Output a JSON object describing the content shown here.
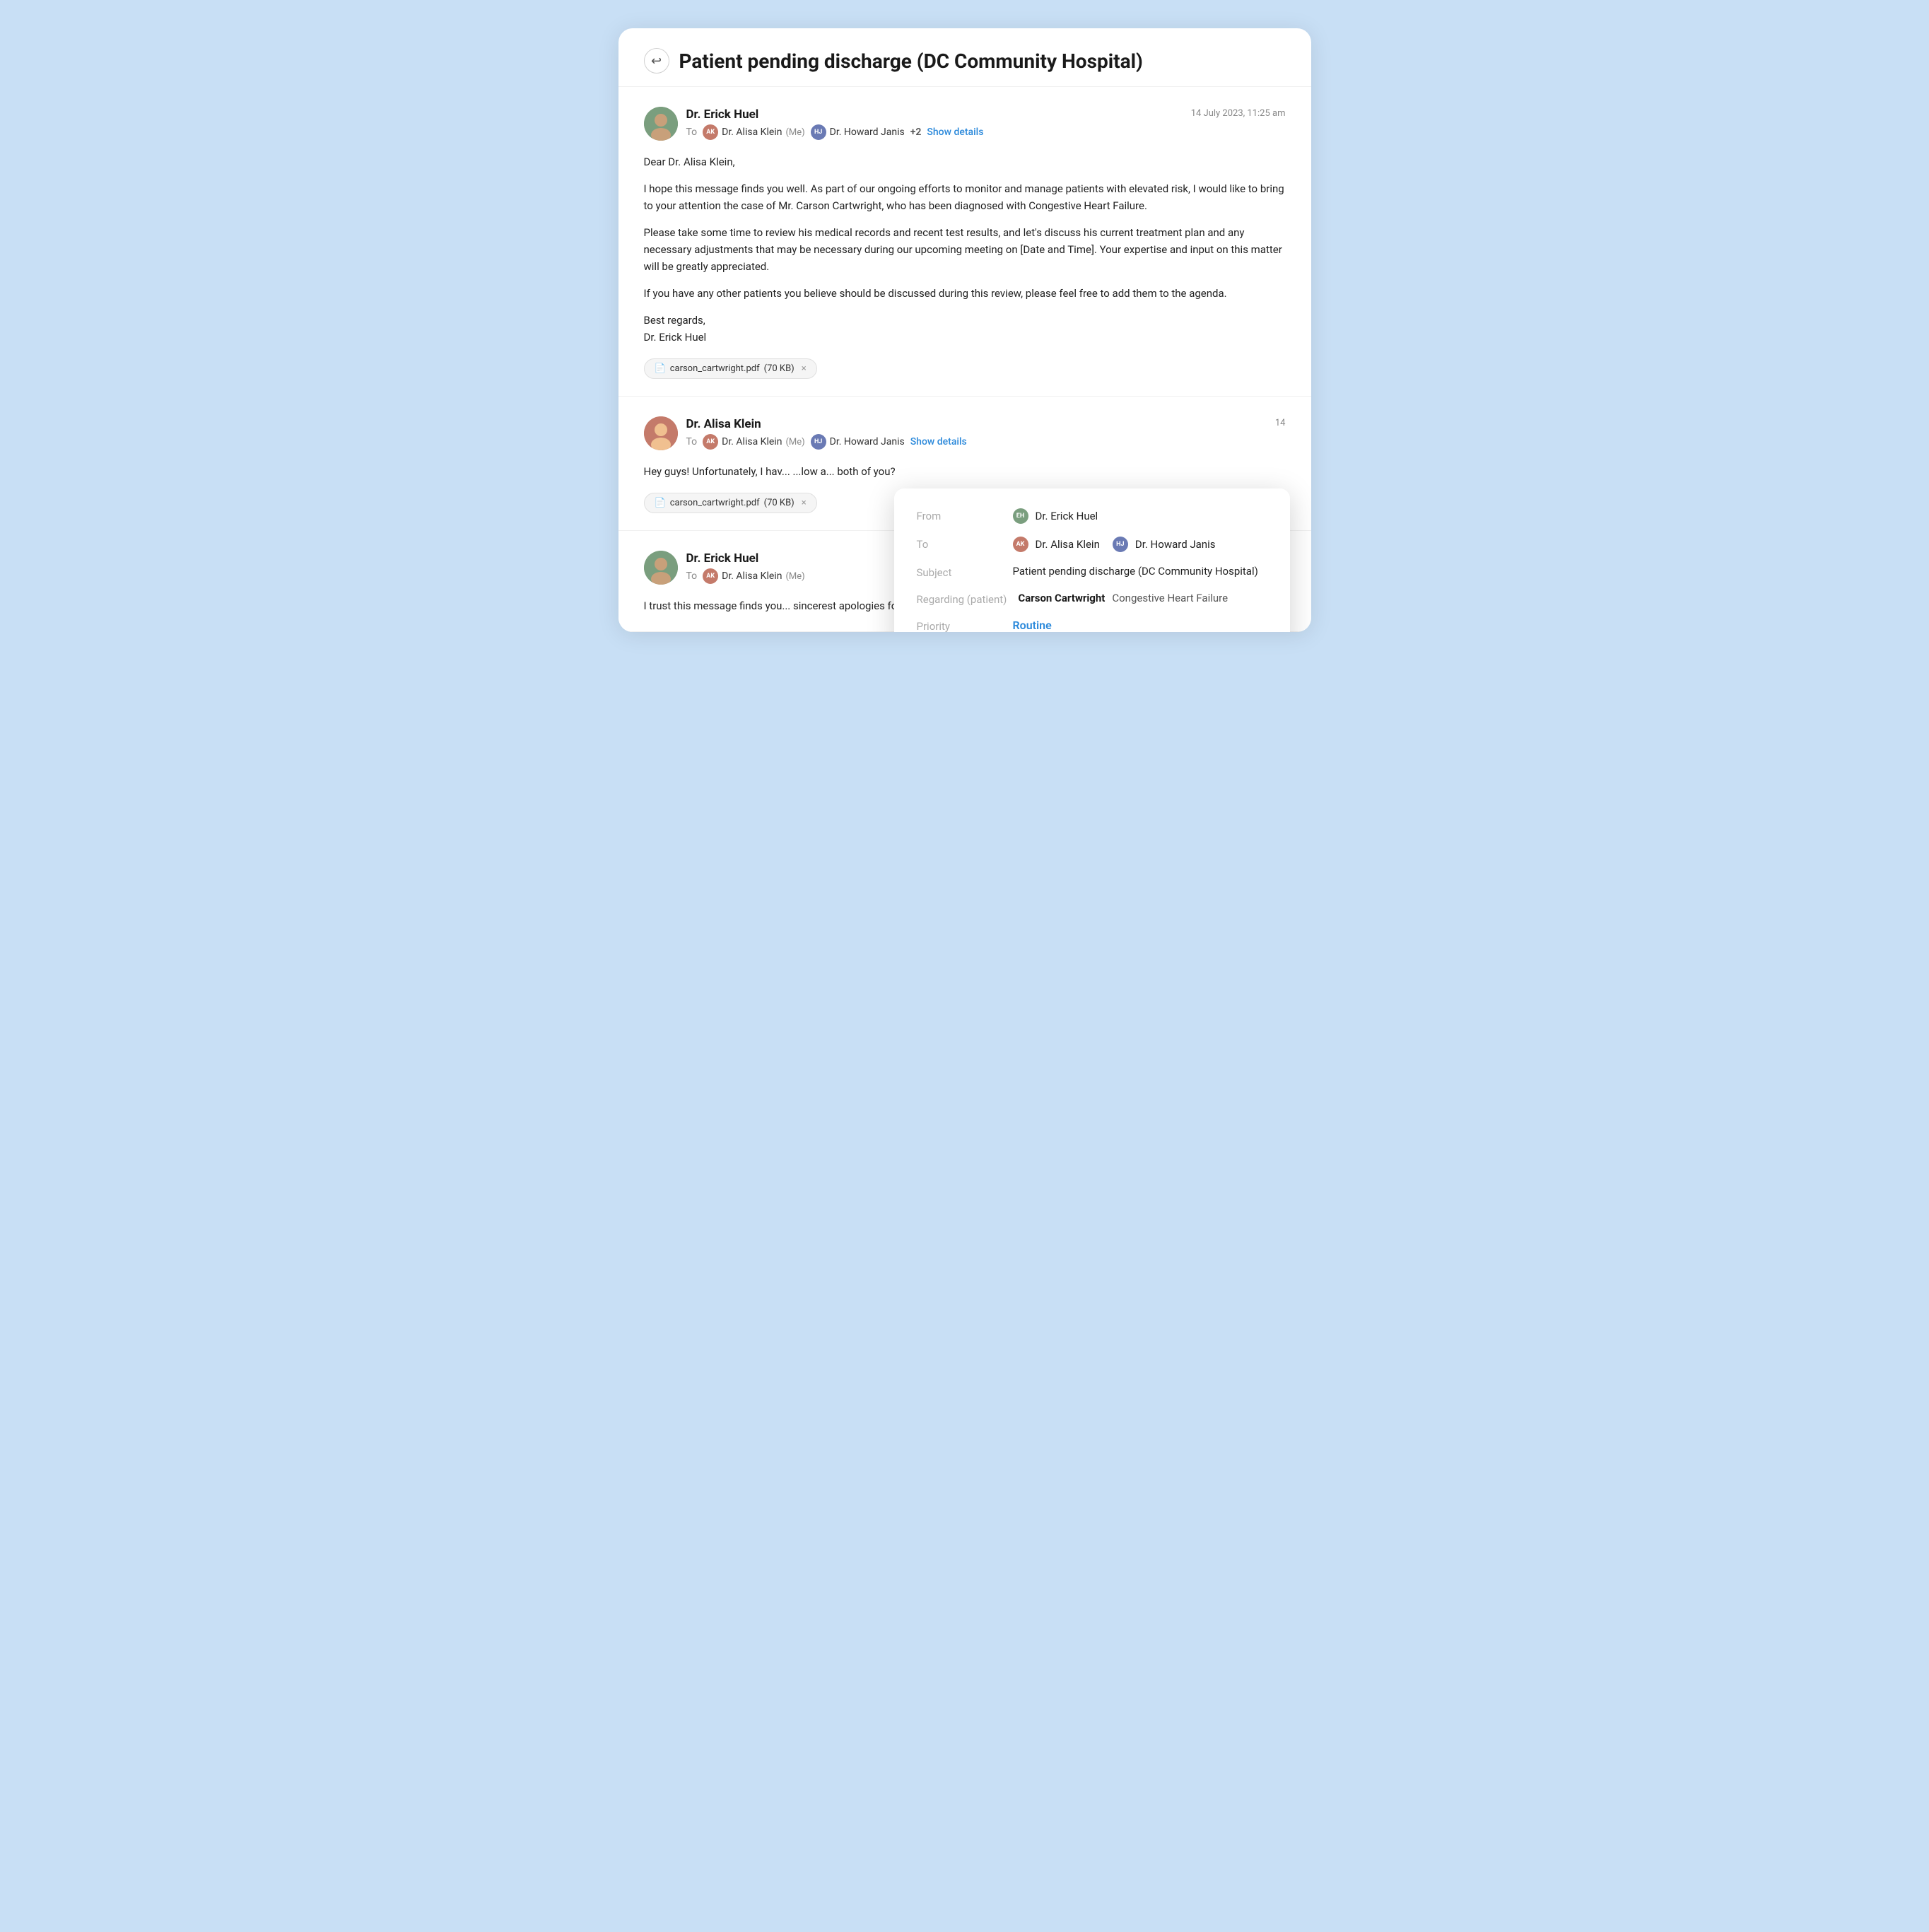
{
  "page": {
    "title": "Patient pending discharge (DC Community Hospital)",
    "back_label": "↩"
  },
  "messages": [
    {
      "id": "msg1",
      "sender_name": "Dr. Erick Huel",
      "sender_avatar_initials": "EH",
      "sender_avatar_class": "avatar-erick",
      "timestamp": "14 July 2023, 11:25 am",
      "to_label": "To",
      "recipients": [
        {
          "name": "Dr. Alisa Klein",
          "me": true,
          "avatar_class": "ra-alisa"
        },
        {
          "name": "Dr. Howard Janis",
          "me": false,
          "avatar_class": "ra-howard"
        }
      ],
      "plus_count": "+2",
      "show_details_label": "Show details",
      "body_paragraphs": [
        "Dear Dr. Alisa Klein,",
        "I hope this message finds you well. As part of our ongoing efforts to monitor and manage patients with elevated risk, I would like to bring to your attention the case of Mr. Carson Cartwright, who has been diagnosed with Congestive Heart Failure.",
        "Please take some time to review his medical records and recent test results, and let's discuss his current treatment plan and any necessary adjustments that may be necessary during our upcoming meeting on [Date and Time]. Your expertise and input on this matter will be greatly appreciated.",
        "If you have any other patients you believe should be discussed during this review, please feel free to add them to the agenda.",
        "Best regards,\nDr. Erick Huel"
      ],
      "attachment": {
        "name": "carson_cartwright.pdf",
        "size": "70 KB"
      }
    },
    {
      "id": "msg2",
      "sender_name": "Dr. Alisa Klein",
      "sender_avatar_initials": "AK",
      "sender_avatar_class": "avatar-alisa",
      "timestamp": "14",
      "to_label": "To",
      "recipients": [
        {
          "name": "Dr. Alisa Klein",
          "me": true,
          "avatar_class": "ra-alisa"
        },
        {
          "name": "Dr. Howard Janis",
          "me": false,
          "avatar_class": "ra-howard"
        }
      ],
      "show_details_label": "Show details",
      "body_paragraphs": [
        "Hey guys! Unfortunately, I hav... ...low a... both of you?"
      ],
      "attachment": {
        "name": "carson_cartwright.pdf",
        "size": "70 KB"
      },
      "has_popup": true
    },
    {
      "id": "msg3",
      "sender_name": "Dr. Erick Huel",
      "sender_avatar_initials": "EH",
      "sender_avatar_class": "avatar-erick",
      "timestamp": "",
      "to_label": "To",
      "recipients": [
        {
          "name": "Dr. Alisa Klein",
          "me": true,
          "avatar_class": "ra-alisa"
        }
      ],
      "body_paragraphs": [
        "I trust this message finds you... ...sincerest apologies for any inc... ...appo..."
      ],
      "attachment": {
        "name": "",
        "size": ""
      }
    }
  ],
  "popup": {
    "from_label": "From",
    "from_name": "Dr. Erick Huel",
    "from_avatar_class": "ra-erick",
    "to_label": "To",
    "to_recipients": [
      {
        "name": "Dr. Alisa Klein",
        "avatar_class": "ra-alisa"
      },
      {
        "name": "Dr. Howard Janis",
        "avatar_class": "ra-howard"
      }
    ],
    "subject_label": "Subject",
    "subject_value": "Patient pending discharge (DC Community Hospital)",
    "regarding_label": "Regarding (patient)",
    "patient_name": "Carson Cartwright",
    "condition": "Congestive Heart Failure",
    "priority_label": "Priority",
    "priority_value": "Routine"
  },
  "icons": {
    "back": "↩",
    "close": "×",
    "pdf_emoji": "📄"
  }
}
